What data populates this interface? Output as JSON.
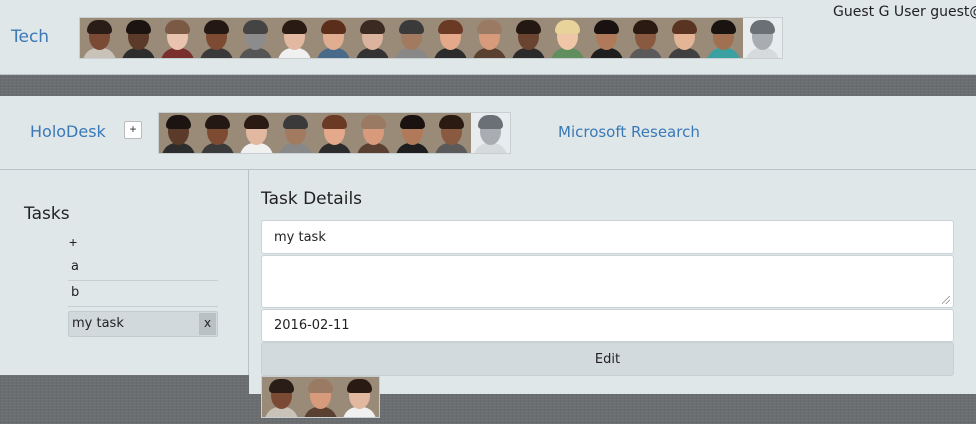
{
  "team": {
    "title": "Tech",
    "members": [
      {
        "icon": "member-avatar",
        "skin": "#7a4a35",
        "hair": "#2a1d18",
        "clothes": "#c9c2b8"
      },
      {
        "icon": "member-avatar",
        "skin": "#5b3a2a",
        "hair": "#1b1411",
        "clothes": "#2d2d2d"
      },
      {
        "icon": "member-avatar",
        "skin": "#e9c3ad",
        "hair": "#7a5a45",
        "clothes": "#7a2f2f"
      },
      {
        "icon": "member-avatar",
        "skin": "#7c4b32",
        "hair": "#231814",
        "clothes": "#3a3a3a"
      },
      {
        "icon": "member-avatar",
        "skin": "#8c8c8c",
        "hair": "#444444",
        "clothes": "#555555"
      },
      {
        "icon": "member-avatar",
        "skin": "#e2b8a0",
        "hair": "#2a1a14",
        "clothes": "#f0f0f0"
      },
      {
        "icon": "member-avatar",
        "skin": "#e0ad90",
        "hair": "#5a2e1a",
        "clothes": "#4a6a8a"
      },
      {
        "icon": "member-avatar",
        "skin": "#dcb39c",
        "hair": "#3a2a22",
        "clothes": "#333333"
      },
      {
        "icon": "member-avatar",
        "skin": "#a27a60",
        "hair": "#3a3a3a",
        "clothes": "#888888"
      },
      {
        "icon": "member-avatar",
        "skin": "#e4a98a",
        "hair": "#6a3a24",
        "clothes": "#2c2c2c"
      },
      {
        "icon": "member-avatar",
        "skin": "#d79a7a",
        "hair": "#9a7a62",
        "clothes": "#5a4030"
      },
      {
        "icon": "member-avatar",
        "skin": "#6a4430",
        "hair": "#231812",
        "clothes": "#2b2b2b"
      },
      {
        "icon": "member-avatar",
        "skin": "#f0c6a8",
        "hair": "#e8d39a",
        "clothes": "#5f8f5f"
      },
      {
        "icon": "member-avatar",
        "skin": "#b07a5a",
        "hair": "#1a1210",
        "clothes": "#1e1e1e"
      },
      {
        "icon": "member-avatar",
        "skin": "#8a5a40",
        "hair": "#2a1a12",
        "clothes": "#5a5a5a"
      },
      {
        "icon": "member-avatar",
        "skin": "#e4b497",
        "hair": "#5a3422",
        "clothes": "#404040"
      },
      {
        "icon": "member-avatar",
        "skin": "#a07050",
        "hair": "#1a1410",
        "clothes": "#3aa0a0"
      },
      {
        "icon": "wolf-avatar",
        "skin": "#a9adb2",
        "hair": "#6b7076",
        "clothes": "#d7dadd"
      }
    ]
  },
  "user": {
    "info": "Guest G User guest@"
  },
  "project": {
    "title": "HoloDesk",
    "add_label": "+",
    "org_label": "Microsoft Research",
    "members": [
      {
        "icon": "member-avatar",
        "skin": "#5b3a2a",
        "hair": "#1b1411",
        "clothes": "#2d2d2d"
      },
      {
        "icon": "member-avatar",
        "skin": "#7c4b32",
        "hair": "#231814",
        "clothes": "#3a3a3a"
      },
      {
        "icon": "member-avatar",
        "skin": "#e2b8a0",
        "hair": "#2a1a14",
        "clothes": "#f0f0f0"
      },
      {
        "icon": "member-avatar",
        "skin": "#a27a60",
        "hair": "#3a3a3a",
        "clothes": "#888888"
      },
      {
        "icon": "member-avatar",
        "skin": "#e4a98a",
        "hair": "#6a3a24",
        "clothes": "#2c2c2c"
      },
      {
        "icon": "member-avatar",
        "skin": "#d79a7a",
        "hair": "#9a7a62",
        "clothes": "#5a4030"
      },
      {
        "icon": "member-avatar",
        "skin": "#b07a5a",
        "hair": "#1a1210",
        "clothes": "#1e1e1e"
      },
      {
        "icon": "member-avatar",
        "skin": "#8a5a40",
        "hair": "#2a1a12",
        "clothes": "#5a5a5a"
      },
      {
        "icon": "wolf-avatar",
        "skin": "#a9adb2",
        "hair": "#6b7076",
        "clothes": "#d7dadd"
      }
    ]
  },
  "tasks": {
    "heading": "Tasks",
    "add_label": "+",
    "items": [
      {
        "label": "a"
      },
      {
        "label": "b"
      },
      {
        "label": "my task",
        "remove_label": "x"
      }
    ]
  },
  "details": {
    "heading": "Task Details",
    "name_value": "my task",
    "description_value": "",
    "date_value": "2016-02-11",
    "edit_label": "Edit",
    "assignees": [
      {
        "icon": "member-avatar",
        "skin": "#7a4a35",
        "hair": "#2a1d18",
        "clothes": "#c9c2b8"
      },
      {
        "icon": "member-avatar",
        "skin": "#d79a7a",
        "hair": "#9a7a62",
        "clothes": "#5a4030"
      },
      {
        "icon": "member-avatar",
        "skin": "#e2b8a0",
        "hair": "#2a1a14",
        "clothes": "#f0f0f0"
      }
    ]
  },
  "colors": {
    "link": "#3a78b8",
    "panel": "#dfe7e9",
    "background": "#6b6e71"
  }
}
